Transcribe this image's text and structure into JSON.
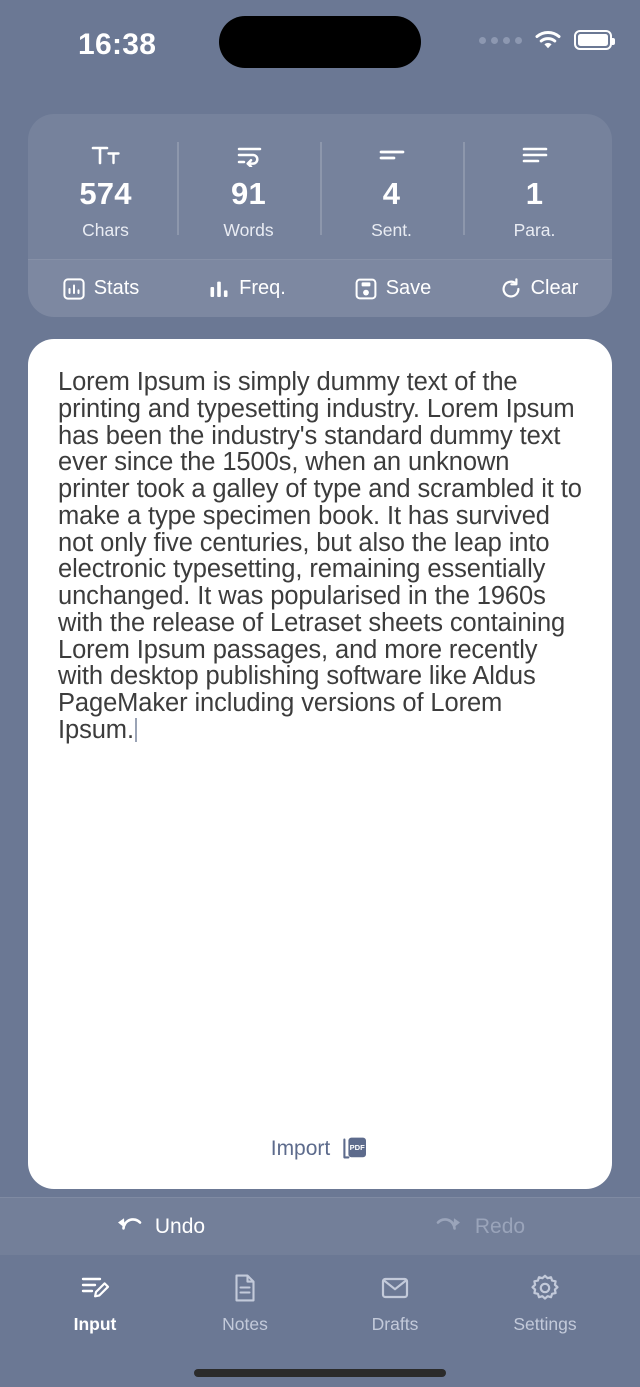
{
  "status_bar": {
    "time": "16:38",
    "signal_icon": "signal-dots-icon",
    "wifi_icon": "wifi-icon",
    "battery_icon": "battery-full-icon"
  },
  "stats": {
    "items": [
      {
        "icon": "format-size-icon",
        "value": "574",
        "label": "Chars"
      },
      {
        "icon": "text-wrap-icon",
        "value": "91",
        "label": "Words"
      },
      {
        "icon": "short-text-icon",
        "value": "4",
        "label": "Sent."
      },
      {
        "icon": "notes-lines-icon",
        "value": "1",
        "label": "Para."
      }
    ]
  },
  "actions": [
    {
      "icon": "stats-chart-icon",
      "label": "Stats"
    },
    {
      "icon": "bar-chart-icon",
      "label": "Freq."
    },
    {
      "icon": "floppy-disk-icon",
      "label": "Save"
    },
    {
      "icon": "refresh-icon",
      "label": "Clear"
    }
  ],
  "editor": {
    "text": "Lorem Ipsum is simply dummy text of the printing and typesetting industry. Lorem Ipsum has been the industry's standard dummy text ever since the 1500s, when an unknown printer took a galley of type and scrambled it to make a type specimen book. It has survived not only five centuries, but also the leap into electronic typesetting, remaining essentially unchanged. It was popularised in the 1960s with the release of Letraset sheets containing Lorem Ipsum passages, and more recently with desktop publishing software like Aldus PageMaker including versions of Lorem Ipsum.",
    "import_label": "Import",
    "import_icon": "pdf-file-icon"
  },
  "history": {
    "undo": {
      "label": "Undo",
      "icon": "undo-arrow-icon",
      "enabled": "true"
    },
    "redo": {
      "label": "Redo",
      "icon": "redo-arrow-icon",
      "enabled": "false"
    }
  },
  "tabs": [
    {
      "icon": "edit-note-icon",
      "label": "Input",
      "active": "true"
    },
    {
      "icon": "document-icon",
      "label": "Notes",
      "active": "false"
    },
    {
      "icon": "envelope-icon",
      "label": "Drafts",
      "active": "false"
    },
    {
      "icon": "gear-icon",
      "label": "Settings",
      "active": "false"
    }
  ],
  "colors": {
    "background": "#6b7894",
    "card": "#ffffff",
    "text": "#3c3c3c",
    "accent": "#5d6b8c",
    "on_dark": "#ffffff",
    "muted": "#9aa4ba"
  }
}
